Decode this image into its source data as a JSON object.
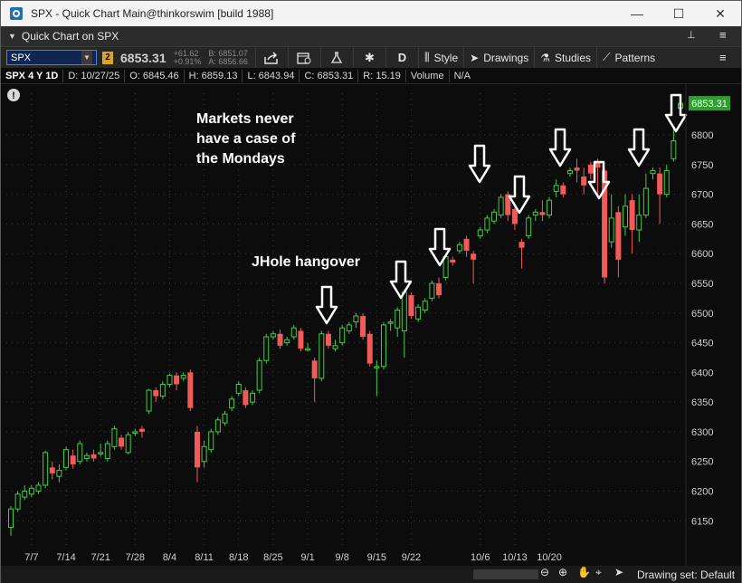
{
  "window": {
    "title": "SPX - Quick Chart Main@thinkorswim [build 1988]",
    "minimize": "—",
    "maximize": "☐",
    "close": "✕"
  },
  "panel": {
    "title": "Quick Chart on SPX",
    "pin": "📌",
    "menu": "≡"
  },
  "toolbar": {
    "symbol": "SPX",
    "link_badge": "2",
    "last": "6853.31",
    "change_abs": "+61.62",
    "change_pct": "+0.91%",
    "bid": "B: 6851.07",
    "ask": "A: 6856.66",
    "aggregation": "D",
    "style_label": "Style",
    "drawings_label": "Drawings",
    "studies_label": "Studies",
    "patterns_label": "Patterns"
  },
  "infobar": {
    "symbol_period": "SPX 4 Y 1D",
    "date": "D: 10/27/25",
    "open": "O: 6845.46",
    "high": "H: 6859.13",
    "low": "L: 6843.94",
    "close": "C: 6853.31",
    "range": "R: 15.19",
    "volume": "Volume",
    "na": "N/A"
  },
  "annotations": {
    "mondays": "Markets never\nhave a case of\nthe Mondays",
    "hangover": "JHole hangover"
  },
  "bottom": {
    "drawing_set": "Drawing set: Default"
  },
  "colors": {
    "up": "#3fcf3f",
    "down": "#f25a5a",
    "grid": "#3a3a3a",
    "price_tag": "#2e9e2e",
    "axis_text": "#d0d0d0"
  },
  "chart_data": {
    "type": "candlestick",
    "ylim": [
      6100,
      6880
    ],
    "y_ticks": [
      6150,
      6200,
      6250,
      6300,
      6350,
      6400,
      6450,
      6500,
      6550,
      6600,
      6650,
      6700,
      6750,
      6800
    ],
    "x_ticks": [
      "7/7",
      "7/14",
      "7/21",
      "7/28",
      "8/4",
      "8/11",
      "8/18",
      "8/25",
      "9/1",
      "9/8",
      "9/15",
      "9/22",
      "10/6",
      "10/13",
      "10/20"
    ],
    "last_price_label": "6853.31",
    "candles": [
      [
        6139,
        6170,
        6125,
        6175
      ],
      [
        6170,
        6195,
        6165,
        6200
      ],
      [
        6190,
        6200,
        6185,
        6210
      ],
      [
        6195,
        6205,
        6190,
        6210
      ],
      [
        6200,
        6210,
        6195,
        6215
      ],
      [
        6210,
        6265,
        6205,
        6268
      ],
      [
        6240,
        6230,
        6220,
        6250
      ],
      [
        6225,
        6235,
        6215,
        6245
      ],
      [
        6240,
        6270,
        6235,
        6275
      ],
      [
        6260,
        6245,
        6238,
        6270
      ],
      [
        6250,
        6280,
        6245,
        6285
      ],
      [
        6255,
        6260,
        6250,
        6265
      ],
      [
        6262,
        6255,
        6250,
        6270
      ],
      [
        6265,
        6265,
        6258,
        6280
      ],
      [
        6255,
        6280,
        6250,
        6285
      ],
      [
        6275,
        6305,
        6270,
        6310
      ],
      [
        6290,
        6275,
        6270,
        6295
      ],
      [
        6265,
        6295,
        6262,
        6300
      ],
      [
        6298,
        6300,
        6293,
        6305
      ],
      [
        6305,
        6300,
        6290,
        6310
      ],
      [
        6335,
        6370,
        6330,
        6372
      ],
      [
        6370,
        6360,
        6350,
        6375
      ],
      [
        6360,
        6380,
        6355,
        6385
      ],
      [
        6380,
        6395,
        6375,
        6398
      ],
      [
        6395,
        6380,
        6370,
        6400
      ],
      [
        6390,
        6395,
        6385,
        6400
      ],
      [
        6400,
        6340,
        6335,
        6405
      ],
      [
        6300,
        6240,
        6215,
        6310
      ],
      [
        6250,
        6275,
        6240,
        6285
      ],
      [
        6270,
        6300,
        6265,
        6305
      ],
      [
        6300,
        6320,
        6295,
        6325
      ],
      [
        6315,
        6330,
        6310,
        6335
      ],
      [
        6340,
        6355,
        6335,
        6360
      ],
      [
        6365,
        6380,
        6360,
        6385
      ],
      [
        6370,
        6345,
        6340,
        6375
      ],
      [
        6350,
        6365,
        6345,
        6370
      ],
      [
        6370,
        6420,
        6365,
        6425
      ],
      [
        6420,
        6460,
        6415,
        6465
      ],
      [
        6460,
        6465,
        6455,
        6470
      ],
      [
        6465,
        6445,
        6440,
        6472
      ],
      [
        6450,
        6455,
        6445,
        6460
      ],
      [
        6460,
        6475,
        6455,
        6480
      ],
      [
        6470,
        6440,
        6435,
        6475
      ],
      [
        6440,
        6440,
        6435,
        6450
      ],
      [
        6420,
        6390,
        6350,
        6425
      ],
      [
        6390,
        6465,
        6385,
        6470
      ],
      [
        6465,
        6445,
        6440,
        6470
      ],
      [
        6440,
        6445,
        6435,
        6455
      ],
      [
        6450,
        6475,
        6445,
        6480
      ],
      [
        6470,
        6480,
        6465,
        6485
      ],
      [
        6485,
        6495,
        6475,
        6500
      ],
      [
        6495,
        6460,
        6455,
        6500
      ],
      [
        6465,
        6415,
        6410,
        6470
      ],
      [
        6410,
        6410,
        6360,
        6420
      ],
      [
        6410,
        6480,
        6405,
        6485
      ],
      [
        6485,
        6485,
        6470,
        6490
      ],
      [
        6475,
        6505,
        6460,
        6510
      ],
      [
        6470,
        6535,
        6425,
        6540
      ],
      [
        6530,
        6495,
        6490,
        6535
      ],
      [
        6490,
        6510,
        6485,
        6515
      ],
      [
        6505,
        6520,
        6500,
        6525
      ],
      [
        6525,
        6550,
        6520,
        6555
      ],
      [
        6550,
        6530,
        6525,
        6560
      ],
      [
        6560,
        6595,
        6555,
        6600
      ],
      [
        6590,
        6585,
        6580,
        6595
      ],
      [
        6605,
        6615,
        6600,
        6620
      ],
      [
        6625,
        6605,
        6595,
        6630
      ],
      [
        6600,
        6590,
        6550,
        6605
      ],
      [
        6630,
        6640,
        6625,
        6645
      ],
      [
        6640,
        6660,
        6635,
        6665
      ],
      [
        6655,
        6670,
        6650,
        6675
      ],
      [
        6665,
        6695,
        6660,
        6700
      ],
      [
        6700,
        6665,
        6655,
        6705
      ],
      [
        6675,
        6650,
        6640,
        6680
      ],
      [
        6620,
        6610,
        6575,
        6625
      ],
      [
        6630,
        6660,
        6625,
        6665
      ],
      [
        6665,
        6670,
        6655,
        6675
      ],
      [
        6670,
        6665,
        6655,
        6690
      ],
      [
        6665,
        6690,
        6660,
        6695
      ],
      [
        6705,
        6715,
        6695,
        6725
      ],
      [
        6715,
        6700,
        6695,
        6720
      ],
      [
        6735,
        6740,
        6730,
        6745
      ],
      [
        6745,
        6740,
        6720,
        6760
      ],
      [
        6730,
        6715,
        6700,
        6745
      ],
      [
        6750,
        6735,
        6725,
        6755
      ],
      [
        6755,
        6745,
        6700,
        6760
      ],
      [
        6740,
        6560,
        6550,
        6745
      ],
      [
        6620,
        6660,
        6610,
        6700
      ],
      [
        6670,
        6590,
        6560,
        6680
      ],
      [
        6645,
        6680,
        6630,
        6700
      ],
      [
        6690,
        6640,
        6600,
        6700
      ],
      [
        6640,
        6665,
        6620,
        6700
      ],
      [
        6665,
        6710,
        6660,
        6735
      ],
      [
        6735,
        6740,
        6725,
        6745
      ],
      [
        6735,
        6700,
        6650,
        6745
      ],
      [
        6700,
        6740,
        6695,
        6750
      ],
      [
        6760,
        6790,
        6755,
        6810
      ],
      [
        6845,
        6853,
        6844,
        6859
      ]
    ]
  }
}
